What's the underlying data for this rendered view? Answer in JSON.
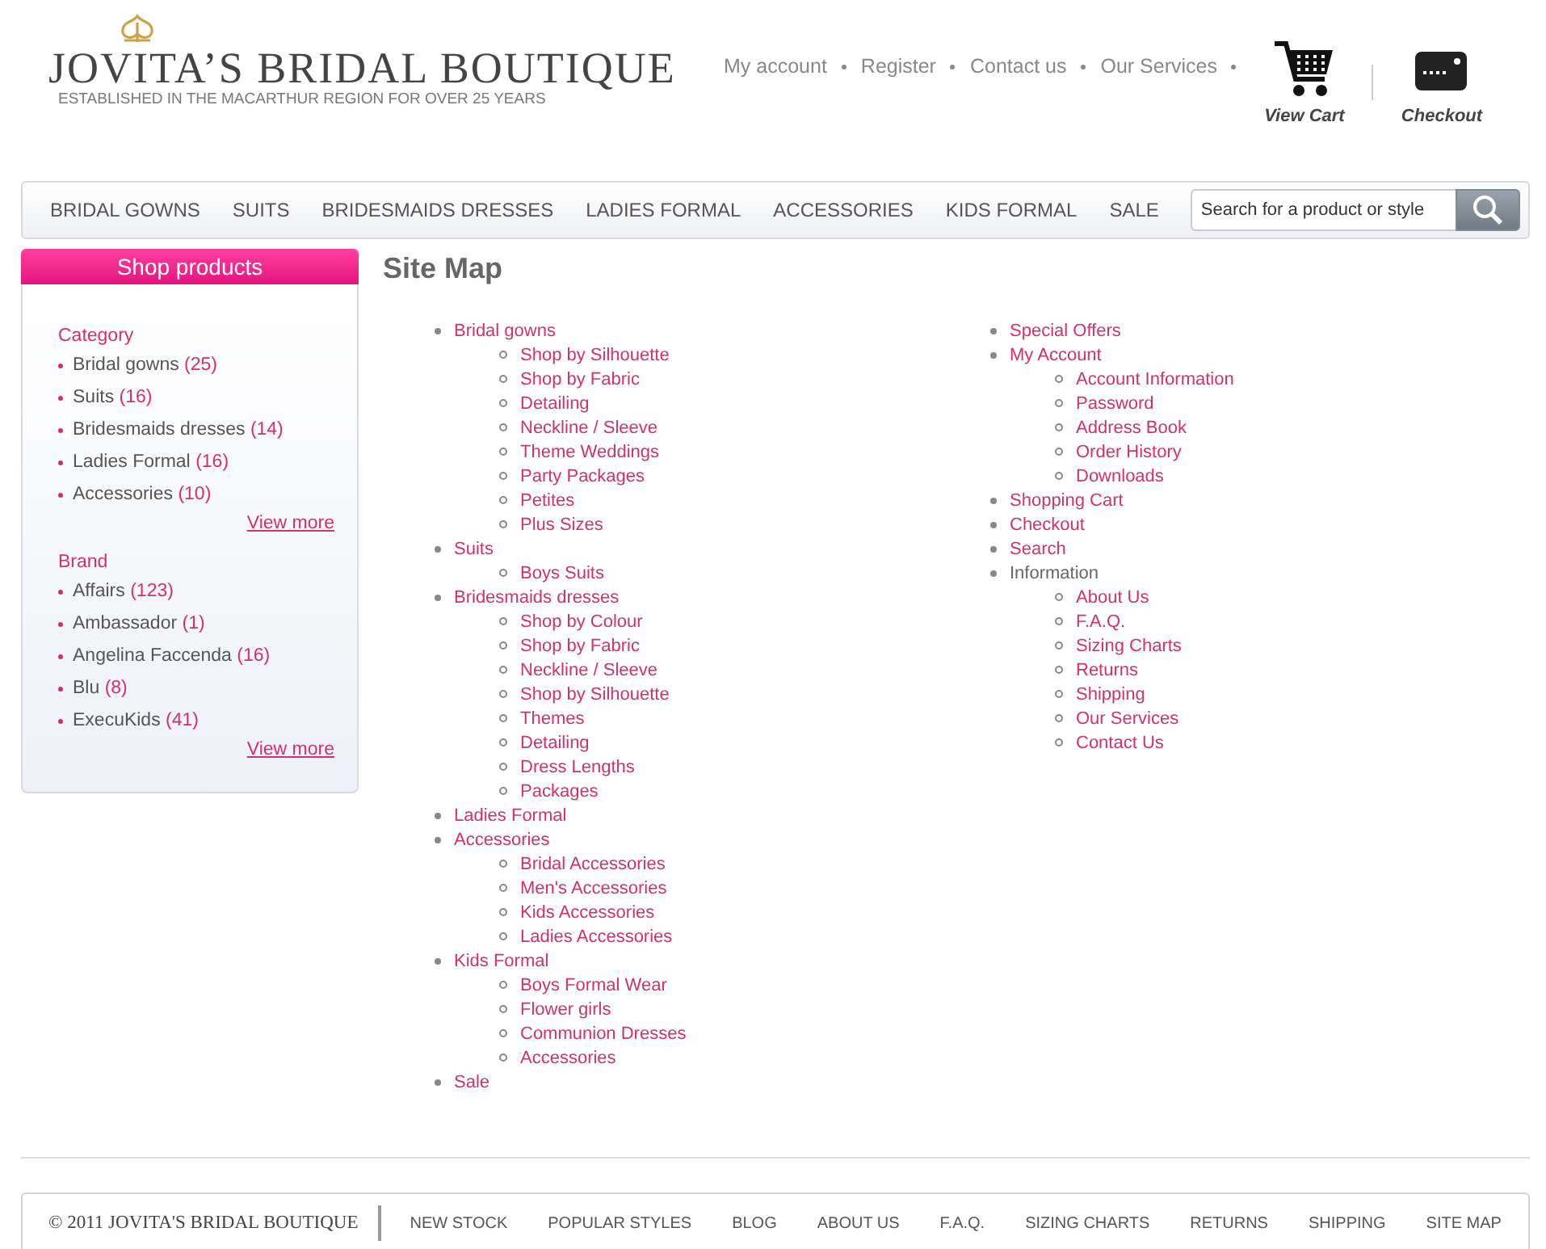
{
  "header": {
    "logo": {
      "title": "JOVITA’S BRIDAL BOUTIQUE",
      "tagline": "ESTABLISHED IN THE MACARTHUR REGION FOR OVER 25 YEARS"
    },
    "top_links": [
      "My account",
      "Register",
      "Contact us",
      "Our Services"
    ],
    "actions": [
      {
        "label": "View Cart",
        "kind": "cart"
      },
      {
        "label": "Checkout",
        "kind": "checkout"
      }
    ]
  },
  "nav": {
    "items": [
      "BRIDAL GOWNS",
      "SUITS",
      "BRIDESMAIDS DRESSES",
      "LADIES FORMAL",
      "ACCESSORIES",
      "KIDS FORMAL",
      "SALE"
    ],
    "search": {
      "placeholder": "Search for a product or style"
    }
  },
  "sidebar": {
    "title": "Shop products",
    "sections": [
      {
        "heading": "Category",
        "items": [
          {
            "label": "Bridal gowns",
            "count": "(25)"
          },
          {
            "label": "Suits",
            "count": "(16)"
          },
          {
            "label": "Bridesmaids dresses",
            "count": "(14)"
          },
          {
            "label": "Ladies Formal",
            "count": "(16)"
          },
          {
            "label": "Accessories",
            "count": "(10)"
          }
        ],
        "more": "View more"
      },
      {
        "heading": "Brand",
        "items": [
          {
            "label": "Affairs",
            "count": "(123)"
          },
          {
            "label": "Ambassador",
            "count": "(1)"
          },
          {
            "label": "Angelina Faccenda",
            "count": "(16)"
          },
          {
            "label": "Blu",
            "count": "(8)"
          },
          {
            "label": "ExecuKids",
            "count": "(41)"
          }
        ],
        "more": "View more"
      }
    ]
  },
  "sitemap": {
    "title": "Site Map",
    "columns": [
      [
        {
          "label": "Bridal gowns",
          "kind": "link",
          "children": [
            {
              "label": "Shop by Silhouette",
              "kind": "link"
            },
            {
              "label": "Shop by Fabric",
              "kind": "link"
            },
            {
              "label": "Detailing",
              "kind": "link"
            },
            {
              "label": "Neckline / Sleeve",
              "kind": "link"
            },
            {
              "label": "Theme Weddings",
              "kind": "link"
            },
            {
              "label": "Party Packages",
              "kind": "link"
            },
            {
              "label": "Petites",
              "kind": "link"
            },
            {
              "label": "Plus Sizes",
              "kind": "link"
            }
          ]
        },
        {
          "label": "Suits",
          "kind": "link",
          "children": [
            {
              "label": "Boys Suits",
              "kind": "link"
            }
          ]
        },
        {
          "label": "Bridesmaids dresses",
          "kind": "link",
          "children": [
            {
              "label": "Shop by Colour",
              "kind": "link"
            },
            {
              "label": "Shop by Fabric",
              "kind": "link"
            },
            {
              "label": "Neckline / Sleeve",
              "kind": "link"
            },
            {
              "label": "Shop by Silhouette",
              "kind": "link"
            },
            {
              "label": "Themes",
              "kind": "link"
            },
            {
              "label": "Detailing",
              "kind": "link"
            },
            {
              "label": "Dress Lengths",
              "kind": "link"
            },
            {
              "label": "Packages",
              "kind": "link"
            }
          ]
        },
        {
          "label": "Ladies Formal",
          "kind": "link"
        },
        {
          "label": "Accessories",
          "kind": "link",
          "children": [
            {
              "label": "Bridal Accessories",
              "kind": "link"
            },
            {
              "label": "Men's Accessories",
              "kind": "link"
            },
            {
              "label": "Kids Accessories",
              "kind": "link"
            },
            {
              "label": "Ladies Accessories",
              "kind": "link"
            }
          ]
        },
        {
          "label": "Kids Formal",
          "kind": "link",
          "children": [
            {
              "label": "Boys Formal Wear",
              "kind": "link"
            },
            {
              "label": "Flower girls",
              "kind": "link"
            },
            {
              "label": "Communion Dresses",
              "kind": "link"
            },
            {
              "label": "Accessories",
              "kind": "link"
            }
          ]
        },
        {
          "label": "Sale",
          "kind": "link"
        }
      ],
      [
        {
          "label": "Special Offers",
          "kind": "link"
        },
        {
          "label": "My Account",
          "kind": "link",
          "children": [
            {
              "label": "Account Information",
              "kind": "link"
            },
            {
              "label": "Password",
              "kind": "link"
            },
            {
              "label": "Address Book",
              "kind": "link"
            },
            {
              "label": "Order History",
              "kind": "link"
            },
            {
              "label": "Downloads",
              "kind": "link"
            }
          ]
        },
        {
          "label": "Shopping Cart",
          "kind": "link"
        },
        {
          "label": "Checkout",
          "kind": "link"
        },
        {
          "label": "Search",
          "kind": "link"
        },
        {
          "label": "Information",
          "kind": "text",
          "children": [
            {
              "label": "About Us",
              "kind": "link"
            },
            {
              "label": "F.A.Q.",
              "kind": "link"
            },
            {
              "label": "Sizing Charts",
              "kind": "link"
            },
            {
              "label": "Returns",
              "kind": "link"
            },
            {
              "label": "Shipping",
              "kind": "link"
            },
            {
              "label": "Our Services",
              "kind": "link"
            },
            {
              "label": "Contact Us",
              "kind": "link"
            }
          ]
        }
      ]
    ]
  },
  "footer": {
    "copyright": "© 2011 JOVITA'S BRIDAL BOUTIQUE",
    "links": [
      "NEW STOCK",
      "POPULAR STYLES",
      "BLOG",
      "ABOUT US",
      "F.A.Q.",
      "SIZING CHARTS",
      "RETURNS",
      "SHIPPING",
      "SITE MAP"
    ]
  }
}
